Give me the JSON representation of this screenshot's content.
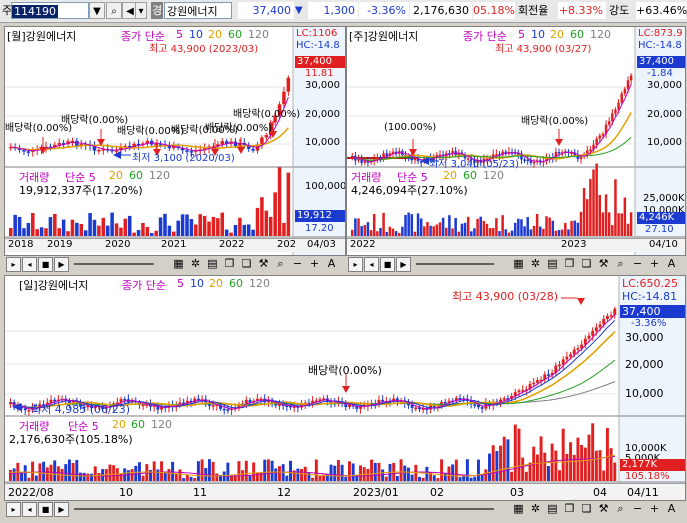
{
  "toolbar": {
    "market": "주",
    "code": "114190",
    "grade": "경",
    "name": "강원에너지",
    "price": "37,400",
    "change": "1,300",
    "change_pct": "-3.36%",
    "volume": "2,176,630",
    "volume_pct": "05.18%",
    "turnover_label": "회전율",
    "turnover": "+8.33%",
    "strength_label": "강도",
    "strength": "+63.46%"
  },
  "monthly": {
    "header_name": "[월]강원에너지",
    "ma_label": "종가 단순",
    "ma": [
      "5",
      "10",
      "20",
      "60",
      "120"
    ],
    "high_note": "최고 43,900 (2023/03)",
    "low_note": "최저 3,100 (2020/03)",
    "dividends": [
      "배당락(0.00%)",
      "배당락(0.00%)",
      "배당락(0.00%)",
      "배당락(0.00%)",
      "배당락(0.00%)",
      "배당락(0.00%)"
    ],
    "lc": "LC:1106",
    "hc": "HC:-14.8",
    "price_tag": "37,400",
    "pct_tag": "11.81",
    "ticks": [
      "30,000",
      "20,000",
      "10,000"
    ],
    "vol_label": "거래량",
    "vol_ma": [
      "단순 5",
      "20",
      "60",
      "120"
    ],
    "vol_value": "19,912,337주(17.20%)",
    "vol_tick": "100,000",
    "vol_tag": "19,912",
    "vol_pct": "17.20",
    "dates": [
      "2018",
      "2019",
      "2020",
      "2021",
      "2022",
      "202",
      "04/03"
    ]
  },
  "weekly": {
    "header_name": "[주]강원에너지",
    "ma_label": "종가 단순",
    "ma": [
      "5",
      "10",
      "20",
      "60",
      "120"
    ],
    "high_note": "최고 43,900 (03/27)",
    "low_note": "최저 3,040 (05/23)",
    "dividends": [
      "(100.00%)",
      "배당락(0.00%)"
    ],
    "lc": "LC:873.9",
    "hc": "HC:-14.8",
    "price_tag": "37,400",
    "pct_tag": "-1.84",
    "ticks": [
      "30,000",
      "20,000",
      "10,000"
    ],
    "vol_label": "거래량",
    "vol_ma": [
      "단순 5",
      "20",
      "60",
      "120"
    ],
    "vol_value": "4,246,094주(27.10%)",
    "vol_tick": "25,000K",
    "vol_tick2": "10,000K",
    "vol_tag": "4,246K",
    "vol_pct": "27.10",
    "dates": [
      "2022",
      "2023",
      "04/10"
    ]
  },
  "daily": {
    "header_name": "[일]강원에너지",
    "ma_label": "종가 단순",
    "ma": [
      "5",
      "10",
      "20",
      "60",
      "120"
    ],
    "high_note": "최고 43,900 (03/28)",
    "low_note": "최저 4,985 (06/23)",
    "dividends": [
      "배당락(0.00%)"
    ],
    "lc": "LC:650.25",
    "hc": "HC:-14.81",
    "price_tag": "37,400",
    "pct_tag": "-3.36%",
    "ticks": [
      "30,000",
      "20,000",
      "10,000"
    ],
    "vol_label": "거래량",
    "vol_ma": [
      "단순 5",
      "20",
      "60",
      "120"
    ],
    "vol_value": "2,176,630주(105.18%)",
    "vol_tick": "10,000K",
    "vol_tick2": "5,000K",
    "vol_tag": "2,177K",
    "vol_pct": "105.18%",
    "dates": [
      "2022/08",
      "10",
      "11",
      "12",
      "2023/01",
      "02",
      "03",
      "04",
      "04/11"
    ]
  },
  "colors": {
    "up": "#e02020",
    "down": "#1a3ad0",
    "ma5": "#c000c0",
    "ma10": "#1a3ad0",
    "ma20": "#e0a000",
    "ma60": "#20a020",
    "ma120": "#808080"
  }
}
